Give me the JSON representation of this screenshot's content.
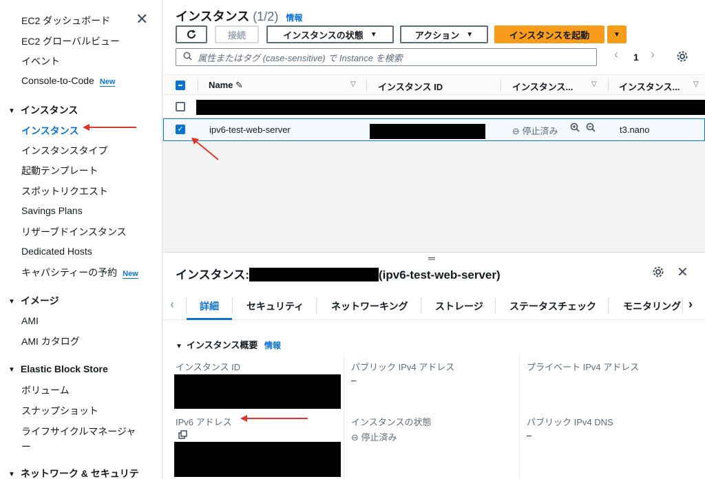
{
  "sidebar": {
    "top_items": [
      "EC2 ダッシュボード",
      "EC2 グローバルビュー",
      "イベント",
      "Console-to-Code"
    ],
    "new_badge": "New",
    "instances_section": "インスタンス",
    "instances_items": [
      "インスタンス",
      "インスタンスタイプ",
      "起動テンプレート",
      "スポットリクエスト",
      "Savings Plans",
      "リザーブドインスタンス",
      "Dedicated Hosts",
      "キャパシティーの予約"
    ],
    "images_section": "イメージ",
    "images_items": [
      "AMI",
      "AMI カタログ"
    ],
    "ebs_section": "Elastic Block Store",
    "ebs_items": [
      "ボリューム",
      "スナップショット",
      "ライフサイクルマネージャー"
    ],
    "network_section": "ネットワーク & セキュリテ"
  },
  "header": {
    "title": "インスタンス",
    "count": "(1/2)",
    "info": "情報"
  },
  "toolbar": {
    "refresh_icon": "refresh-icon",
    "connect": "接続",
    "instance_state": "インスタンスの状態",
    "actions": "アクション",
    "launch": "インスタンスを起動"
  },
  "search": {
    "placeholder": "属性またはタグ (case-sensitive) で Instance を検索"
  },
  "pagination": {
    "page": "1"
  },
  "table": {
    "columns": [
      "Name",
      "インスタンス ID",
      "インスタンス...",
      "インスタンス..."
    ],
    "rows": [
      {
        "name": "",
        "state": "",
        "type": ""
      },
      {
        "name": "ipv6-test-web-server",
        "state": "停止済み",
        "type": "t3.nano"
      }
    ]
  },
  "detail": {
    "title_prefix": "インスタンス:",
    "title_suffix": "(ipv6-test-web-server)",
    "tabs": [
      "詳細",
      "セキュリティ",
      "ネットワーキング",
      "ストレージ",
      "ステータスチェック",
      "モニタリング"
    ],
    "summary_title": "インスタンス概要",
    "summary_info": "情報",
    "fields": {
      "instance_id_label": "インスタンス ID",
      "public_ipv4_label": "パブリック IPv4 アドレス",
      "public_ipv4_value": "–",
      "private_ipv4_label": "プライベート IPv4 アドレス",
      "ipv6_label": "IPv6 アドレス",
      "state_label": "インスタンスの状態",
      "state_value": "停止済み",
      "public_dns_label": "パブリック IPv4 DNS",
      "public_dns_value": "–"
    }
  },
  "colors": {
    "accent": "#0972d3",
    "primary_button": "#f89c1c",
    "annotation_arrow": "#e0352b"
  }
}
